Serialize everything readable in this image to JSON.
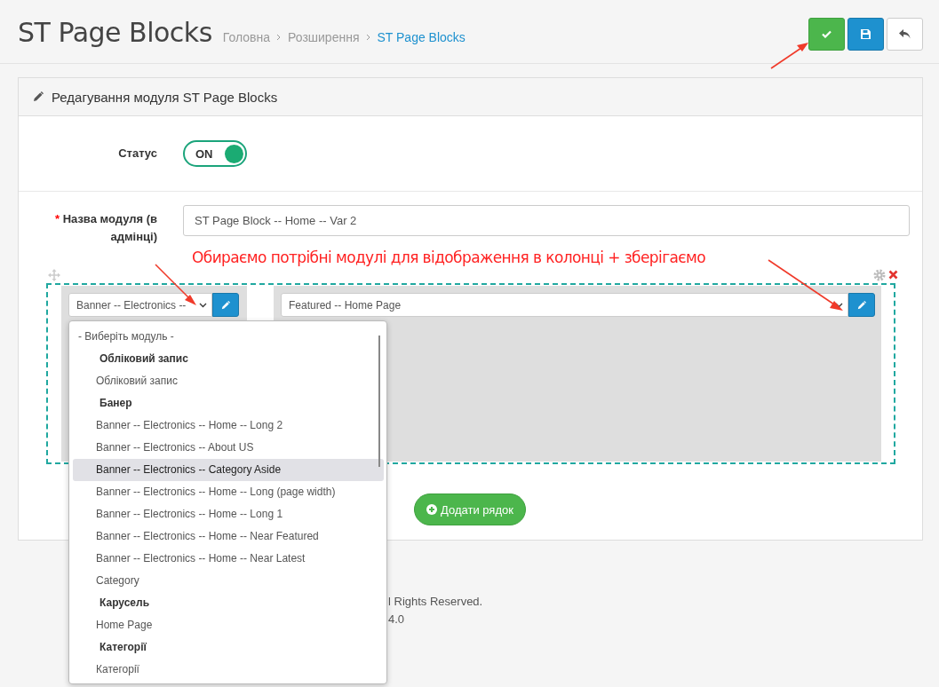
{
  "header": {
    "title": "ST Page Blocks",
    "breadcrumbs": [
      {
        "label": "Головна",
        "current": false
      },
      {
        "label": "Розширення",
        "current": false
      },
      {
        "label": "ST Page Blocks",
        "current": true
      }
    ],
    "buttons": [
      {
        "kind": "save"
      },
      {
        "kind": "save-stay"
      },
      {
        "kind": "back"
      }
    ]
  },
  "panel": {
    "heading": "Редагування модуля ST Page Blocks",
    "status": {
      "label": "Статус",
      "on": true,
      "text": "ON"
    },
    "name_field": {
      "required_mark": "*",
      "label": "Назва модуля (в адмінці)",
      "value": "ST Page Block -- Home -- Var 2"
    },
    "annotation": "Обираємо потрібні модулі для відображення в колонці + зберігаємо",
    "columns": [
      {
        "value": "Banner -- Electronics --"
      },
      {
        "value": "Featured -- Home Page"
      }
    ],
    "add_row_button": "Додати рядок"
  },
  "dropdown": {
    "options": [
      {
        "kind": "placeholder",
        "label": "- Виберіть модуль -",
        "selected": false
      },
      {
        "kind": "group",
        "label": "Обліковий запис",
        "selected": false
      },
      {
        "kind": "option",
        "label": "Обліковий запис",
        "selected": false
      },
      {
        "kind": "group",
        "label": "Банер",
        "selected": false
      },
      {
        "kind": "option",
        "label": "Banner -- Electronics -- Home -- Long 2",
        "selected": false
      },
      {
        "kind": "option",
        "label": "Banner -- Electronics -- About US",
        "selected": false
      },
      {
        "kind": "option",
        "label": "Banner -- Electronics -- Category Aside",
        "selected": true
      },
      {
        "kind": "option",
        "label": "Banner -- Electronics -- Home -- Long (page width)",
        "selected": false
      },
      {
        "kind": "option",
        "label": "Banner -- Electronics -- Home -- Long 1",
        "selected": false
      },
      {
        "kind": "option",
        "label": "Banner -- Electronics -- Home -- Near Featured",
        "selected": false
      },
      {
        "kind": "option",
        "label": "Banner -- Electronics -- Home -- Near Latest",
        "selected": false
      },
      {
        "kind": "option",
        "label": "Category",
        "selected": false
      },
      {
        "kind": "group",
        "label": "Карусель",
        "selected": false
      },
      {
        "kind": "option",
        "label": "Home Page",
        "selected": false
      },
      {
        "kind": "group",
        "label": "Категорії",
        "selected": false
      },
      {
        "kind": "option",
        "label": "Категорії",
        "selected": false
      }
    ]
  },
  "footer": [
    "l Rights Reserved.",
    "4.0"
  ]
}
